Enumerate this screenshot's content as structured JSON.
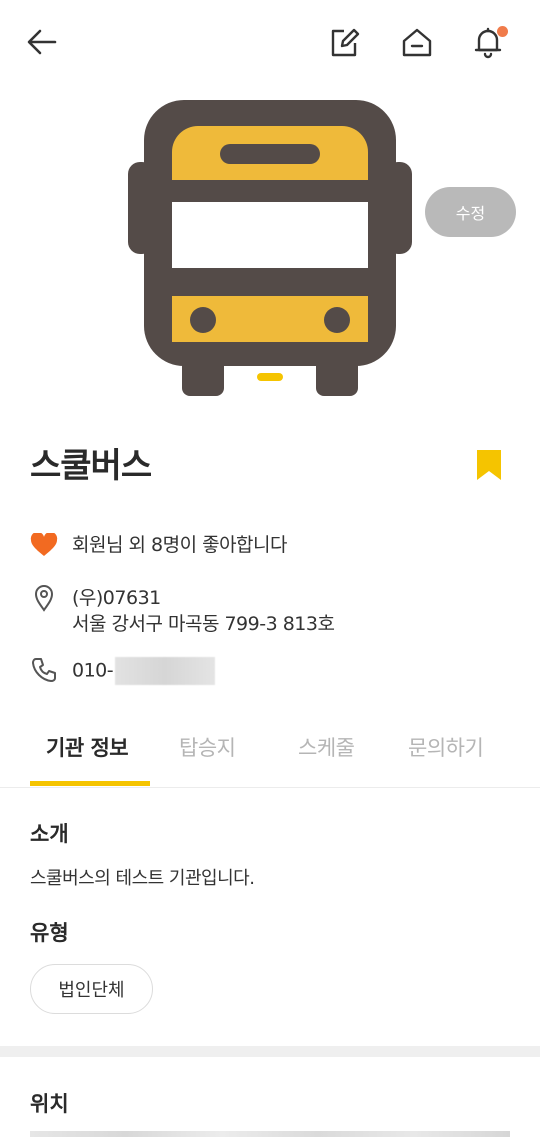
{
  "header": {
    "back_icon": "arrow-left-icon",
    "edit_icon": "edit-icon",
    "home_icon": "home-icon",
    "bell_icon": "bell-icon",
    "notification_dot_color": "#f07b4a"
  },
  "hero": {
    "image": "school-bus-icon",
    "edit_button_label": "수정"
  },
  "organization": {
    "name": "스쿨버스",
    "bookmark_color": "#f5c400",
    "likes_text": "회원님 외 8명이 좋아합니다",
    "postal_code": "(우)07631",
    "address": "서울 강서구 마곡동 799-3 813호",
    "phone_prefix": "010-"
  },
  "tabs": [
    {
      "label": "기관 정보",
      "active": true
    },
    {
      "label": "탑승지",
      "active": false
    },
    {
      "label": "스케줄",
      "active": false
    },
    {
      "label": "문의하기",
      "active": false
    }
  ],
  "intro": {
    "heading": "소개",
    "text": "스쿨버스의 테스트 기관입니다."
  },
  "type": {
    "heading": "유형",
    "chip": "법인단체"
  },
  "location": {
    "heading": "위치"
  },
  "colors": {
    "accent": "#f5c400",
    "heart": "#f26a21",
    "bus_body": "#544b48",
    "bus_yellow": "#efba3a"
  }
}
